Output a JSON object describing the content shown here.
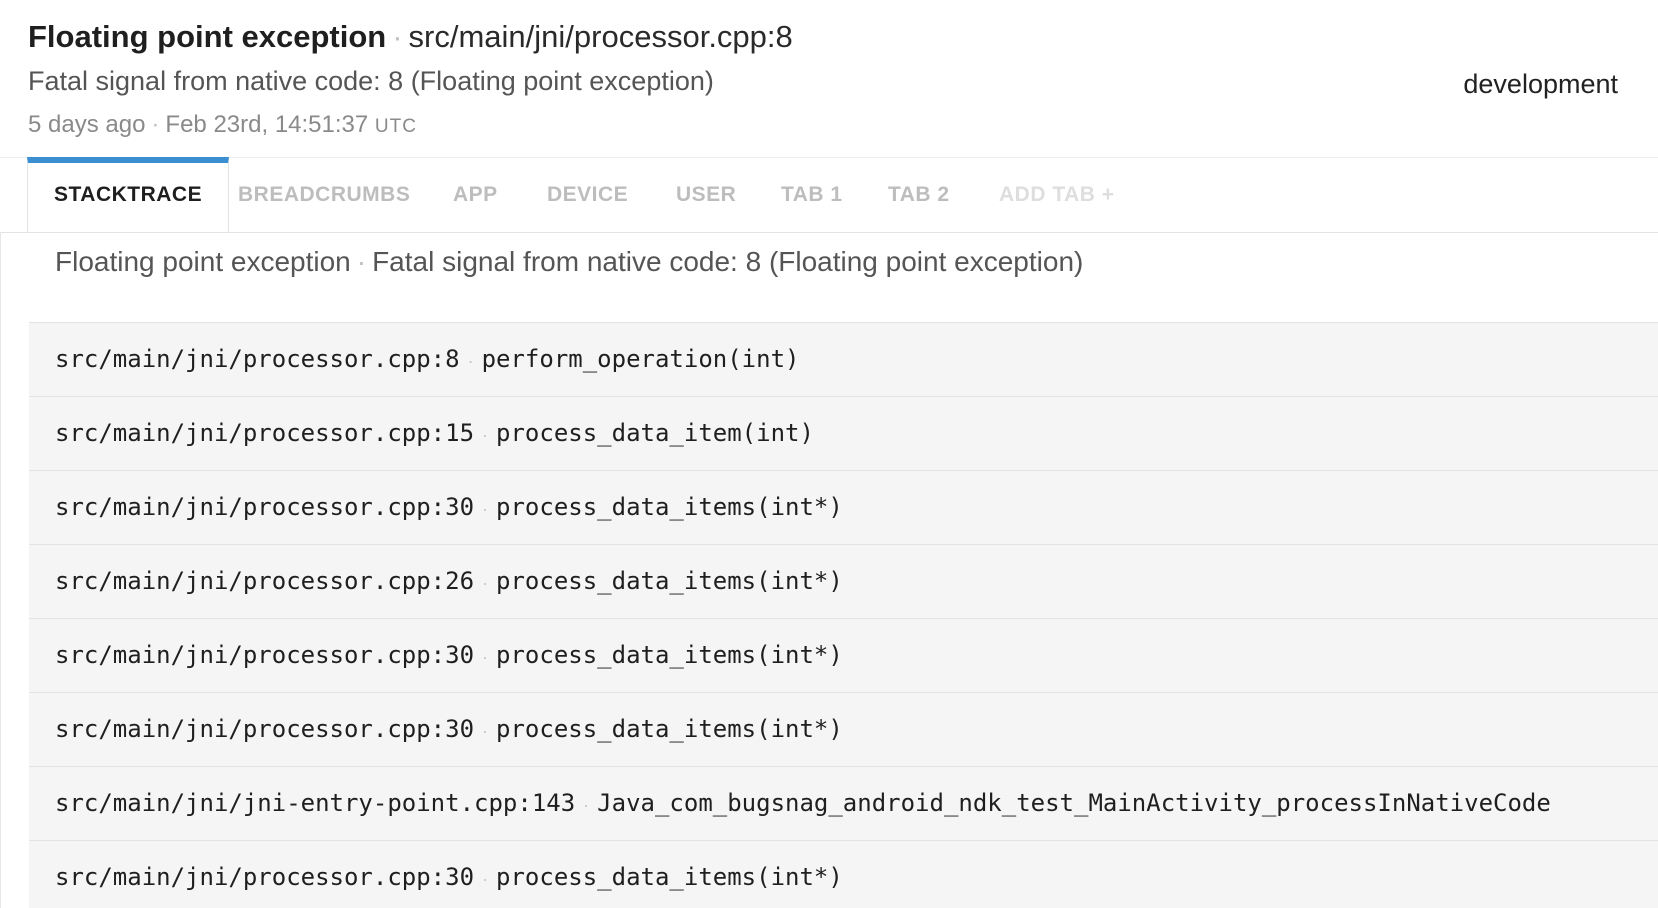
{
  "header": {
    "error_class": "Floating point exception",
    "location": "src/main/jni/processor.cpp:8",
    "message": "Fatal signal from native code: 8 (Floating point exception)",
    "relative_time": "5 days ago",
    "timestamp": "Feb 23rd, 14:51:37",
    "timezone": "UTC",
    "environment": "development"
  },
  "tabs": [
    {
      "label": "STACKTRACE",
      "active": true
    },
    {
      "label": "BREADCRUMBS",
      "active": false
    },
    {
      "label": "APP",
      "active": false
    },
    {
      "label": "DEVICE",
      "active": false
    },
    {
      "label": "USER",
      "active": false
    },
    {
      "label": "TAB 1",
      "active": false
    },
    {
      "label": "TAB 2",
      "active": false
    },
    {
      "label": "ADD TAB +",
      "active": false
    }
  ],
  "summary": {
    "error_class": "Floating point exception",
    "message": "Fatal signal from native code: 8 (Floating point exception)"
  },
  "frames": [
    {
      "file": "src/main/jni/processor.cpp:8",
      "method": "perform_operation(int)"
    },
    {
      "file": "src/main/jni/processor.cpp:15",
      "method": "process_data_item(int)"
    },
    {
      "file": "src/main/jni/processor.cpp:30",
      "method": "process_data_items(int*)"
    },
    {
      "file": "src/main/jni/processor.cpp:26",
      "method": "process_data_items(int*)"
    },
    {
      "file": "src/main/jni/processor.cpp:30",
      "method": "process_data_items(int*)"
    },
    {
      "file": "src/main/jni/processor.cpp:30",
      "method": "process_data_items(int*)"
    },
    {
      "file": "src/main/jni/jni-entry-point.cpp:143",
      "method": "Java_com_bugsnag_android_ndk_test_MainActivity_processInNativeCode"
    },
    {
      "file": "src/main/jni/processor.cpp:30",
      "method": "process_data_items(int*)"
    }
  ],
  "colors": {
    "active_tab_accent": "#3b8fd0",
    "frame_background": "#f5f5f5"
  }
}
